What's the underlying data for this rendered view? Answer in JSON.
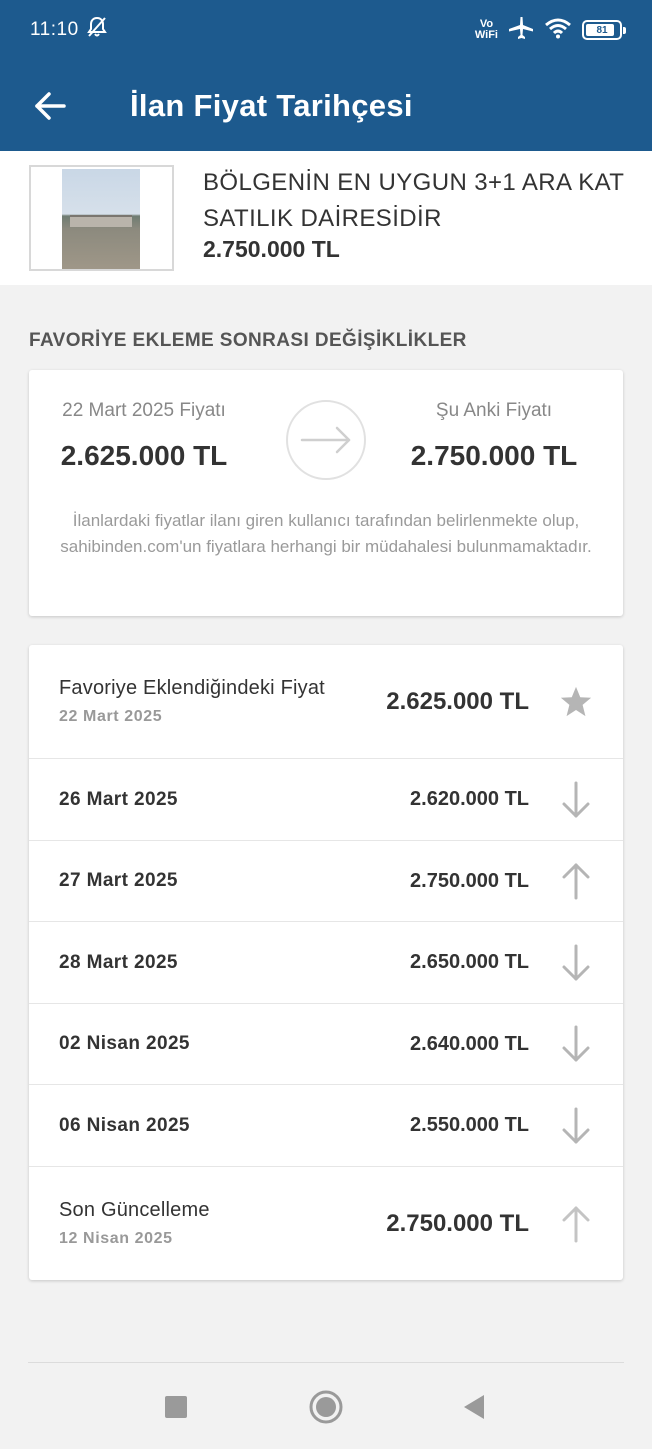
{
  "status_bar": {
    "time": "11:10",
    "vowifi_top": "Vo",
    "vowifi_bottom": "WiFi",
    "battery": "81"
  },
  "app_bar": {
    "title": "İlan Fiyat Tarihçesi"
  },
  "listing": {
    "title": "BÖLGENİN EN UYGUN 3+1 ARA KAT SATILIK DAİRESİDİR",
    "price": "2.750.000 TL"
  },
  "section": {
    "title": "FAVORİYE EKLEME SONRASI DEĞİŞİKLİKLER"
  },
  "comparison": {
    "left_label": "22 Mart 2025 Fiyatı",
    "left_value": "2.625.000 TL",
    "right_label": "Şu Anki Fiyatı",
    "right_value": "2.750.000 TL",
    "disclaimer": "İlanlardaki fiyatlar ilanı giren kullanıcı tarafından belirlenmekte olup, sahibinden.com'un fiyatlara herhangi bir müdahalesi bulunmamaktadır."
  },
  "history": {
    "favorite": {
      "label": "Favoriye Eklendiğindeki Fiyat",
      "date": "22 Mart 2025",
      "price": "2.625.000 TL",
      "icon": "star-icon"
    },
    "changes": [
      {
        "date": "26 Mart 2025",
        "price": "2.620.000 TL",
        "direction": "down"
      },
      {
        "date": "27 Mart 2025",
        "price": "2.750.000 TL",
        "direction": "up"
      },
      {
        "date": "28 Mart 2025",
        "price": "2.650.000 TL",
        "direction": "down"
      },
      {
        "date": "02 Nisan 2025",
        "price": "2.640.000 TL",
        "direction": "down"
      },
      {
        "date": "06 Nisan 2025",
        "price": "2.550.000 TL",
        "direction": "down"
      }
    ],
    "last_update": {
      "label": "Son Güncelleme",
      "date": "12 Nisan 2025",
      "price": "2.750.000 TL",
      "direction": "up"
    }
  },
  "colors": {
    "app_bar": "#1d5a8e",
    "background": "#f2f2f2",
    "icon_gray": "#b5b5b5"
  }
}
